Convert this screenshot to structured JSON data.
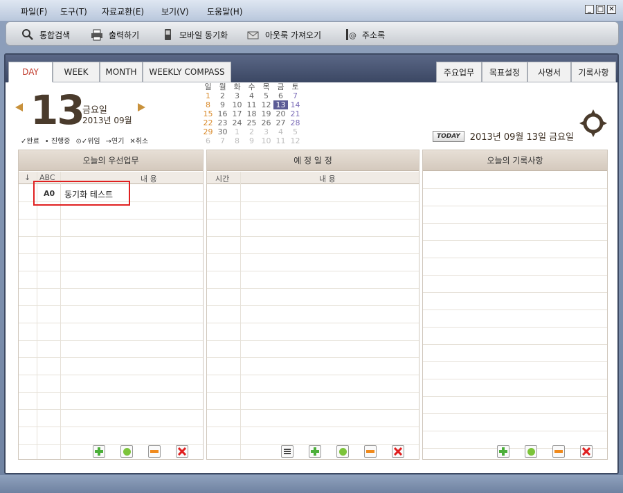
{
  "menu": [
    "파일(F)",
    "도구(T)",
    "자료교환(E)",
    "보기(V)",
    "도움말(H)"
  ],
  "window_controls": [
    "_",
    "□",
    "✕"
  ],
  "toolbar": [
    {
      "label": "통합검색",
      "icon": "search-icon"
    },
    {
      "label": "출력하기",
      "icon": "printer-icon"
    },
    {
      "label": "모바일 동기화",
      "icon": "mobile-icon"
    },
    {
      "label": "아웃룩 가져오기",
      "icon": "outlook-icon"
    },
    {
      "label": "주소록",
      "icon": "address-book-icon"
    }
  ],
  "tabs_left": [
    "DAY",
    "WEEK",
    "MONTH",
    "WEEKLY COMPASS"
  ],
  "tabs_right": [
    "주요업무",
    "목표설정",
    "사명서",
    "기록사항"
  ],
  "date": {
    "day": "13",
    "dow": "금요일",
    "ym": "2013년 09월"
  },
  "legend": [
    "✓완료",
    "• 진행중",
    "⊙✓위임",
    "→연기",
    "✕취소"
  ],
  "mini_calendar": {
    "headers": [
      "일",
      "월",
      "화",
      "수",
      "목",
      "금",
      "토"
    ],
    "weeks": [
      [
        "1",
        "2",
        "3",
        "4",
        "5",
        "6",
        "7"
      ],
      [
        "8",
        "9",
        "10",
        "11",
        "12",
        "13",
        "14"
      ],
      [
        "15",
        "16",
        "17",
        "18",
        "19",
        "20",
        "21"
      ],
      [
        "22",
        "23",
        "24",
        "25",
        "26",
        "27",
        "28"
      ],
      [
        "29",
        "30",
        "1",
        "2",
        "3",
        "4",
        "5"
      ],
      [
        "6",
        "7",
        "8",
        "9",
        "10",
        "11",
        "12"
      ]
    ],
    "today": "13"
  },
  "today_badge": "TODAY",
  "today_text": "2013년 09월 13일 금요일",
  "panels": {
    "priority": {
      "title": "오늘의 우선업무",
      "col_arrow": "↓",
      "col_abc": "ABC",
      "col_content": "내 용",
      "task": {
        "code": "A0",
        "text": "동기화 테스트"
      }
    },
    "schedule": {
      "title": "예 정 일 정",
      "col_time": "시간",
      "col_content": "내 용"
    },
    "notes": {
      "title": "오늘의 기록사항"
    }
  },
  "colors": {
    "accent": "#c0392b",
    "brown": "#4a3b2c",
    "header_bg": "#e7dfd6",
    "today_cell": "#5c5c96"
  }
}
